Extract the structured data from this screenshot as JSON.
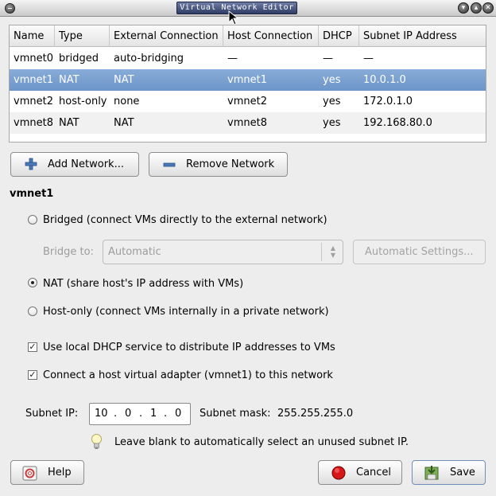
{
  "window": {
    "title": "Virtual Network Editor"
  },
  "table": {
    "columns": [
      "Name",
      "Type",
      "External Connection",
      "Host Connection",
      "DHCP",
      "Subnet IP Address"
    ],
    "rows": [
      [
        "vmnet0",
        "bridged",
        "auto-bridging",
        "—",
        "—",
        "—"
      ],
      [
        "vmnet1",
        "NAT",
        "NAT",
        "vmnet1",
        "yes",
        "10.0.1.0"
      ],
      [
        "vmnet2",
        "host-only",
        "none",
        "vmnet2",
        "yes",
        "172.0.1.0"
      ],
      [
        "vmnet8",
        "NAT",
        "NAT",
        "vmnet8",
        "yes",
        "192.168.80.0"
      ]
    ],
    "selected_row": 1
  },
  "buttons": {
    "add_network": "Add Network...",
    "remove_network": "Remove Network",
    "help": "Help",
    "cancel": "Cancel",
    "save": "Save"
  },
  "section": {
    "title": "vmnet1",
    "bridged": {
      "label": "Bridged (connect VMs directly to the external network)",
      "selected": false
    },
    "bridge_to": {
      "label": "Bridge to:",
      "value": "Automatic",
      "settings_button": "Automatic Settings..."
    },
    "nat": {
      "label": "NAT (share host's IP address with VMs)",
      "selected": true
    },
    "host_only": {
      "label": "Host-only (connect VMs internally in a private network)",
      "selected": false
    },
    "dhcp": {
      "label": "Use local DHCP service to distribute IP addresses to VMs",
      "checked": true
    },
    "host_adapter": {
      "label": "Connect a host virtual adapter (vmnet1) to this network",
      "checked": true
    },
    "subnet_ip": {
      "label": "Subnet IP:",
      "octets": [
        "10",
        "0",
        "1",
        "0"
      ]
    },
    "subnet_mask": {
      "label": "Subnet mask:",
      "value": "255.255.255.0"
    },
    "hint": "Leave blank to automatically select an unused subnet IP."
  }
}
